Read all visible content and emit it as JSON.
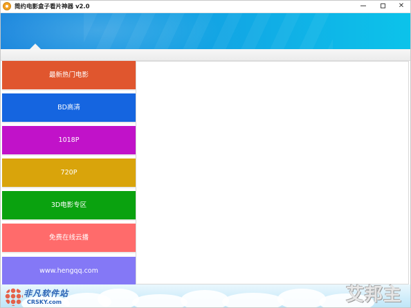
{
  "window": {
    "title": "简约电影盒子看片神器 v2.0",
    "minimize_label": "",
    "maximize_label": "",
    "close_label": "✕"
  },
  "colors": {
    "header_gradient_start": "#1a86dd",
    "header_gradient_end": "#0cc3ea"
  },
  "sidebar": {
    "items": [
      {
        "label": "最新热门电影",
        "color": "#e0562e"
      },
      {
        "label": "BD高清",
        "color": "#1565e0"
      },
      {
        "label": "1018P",
        "color": "#c112c9"
      },
      {
        "label": "720P",
        "color": "#d9a40b"
      },
      {
        "label": "3D电影专区",
        "color": "#0aa20f"
      },
      {
        "label": "免费在线云播",
        "color": "#ff6b6b"
      },
      {
        "label": "www.hengqq.com",
        "color": "#8478f6"
      }
    ]
  },
  "watermark_left": {
    "line1": "非凡软件站",
    "line2": "CRSKY.com"
  },
  "watermark_right": "艾邦主"
}
